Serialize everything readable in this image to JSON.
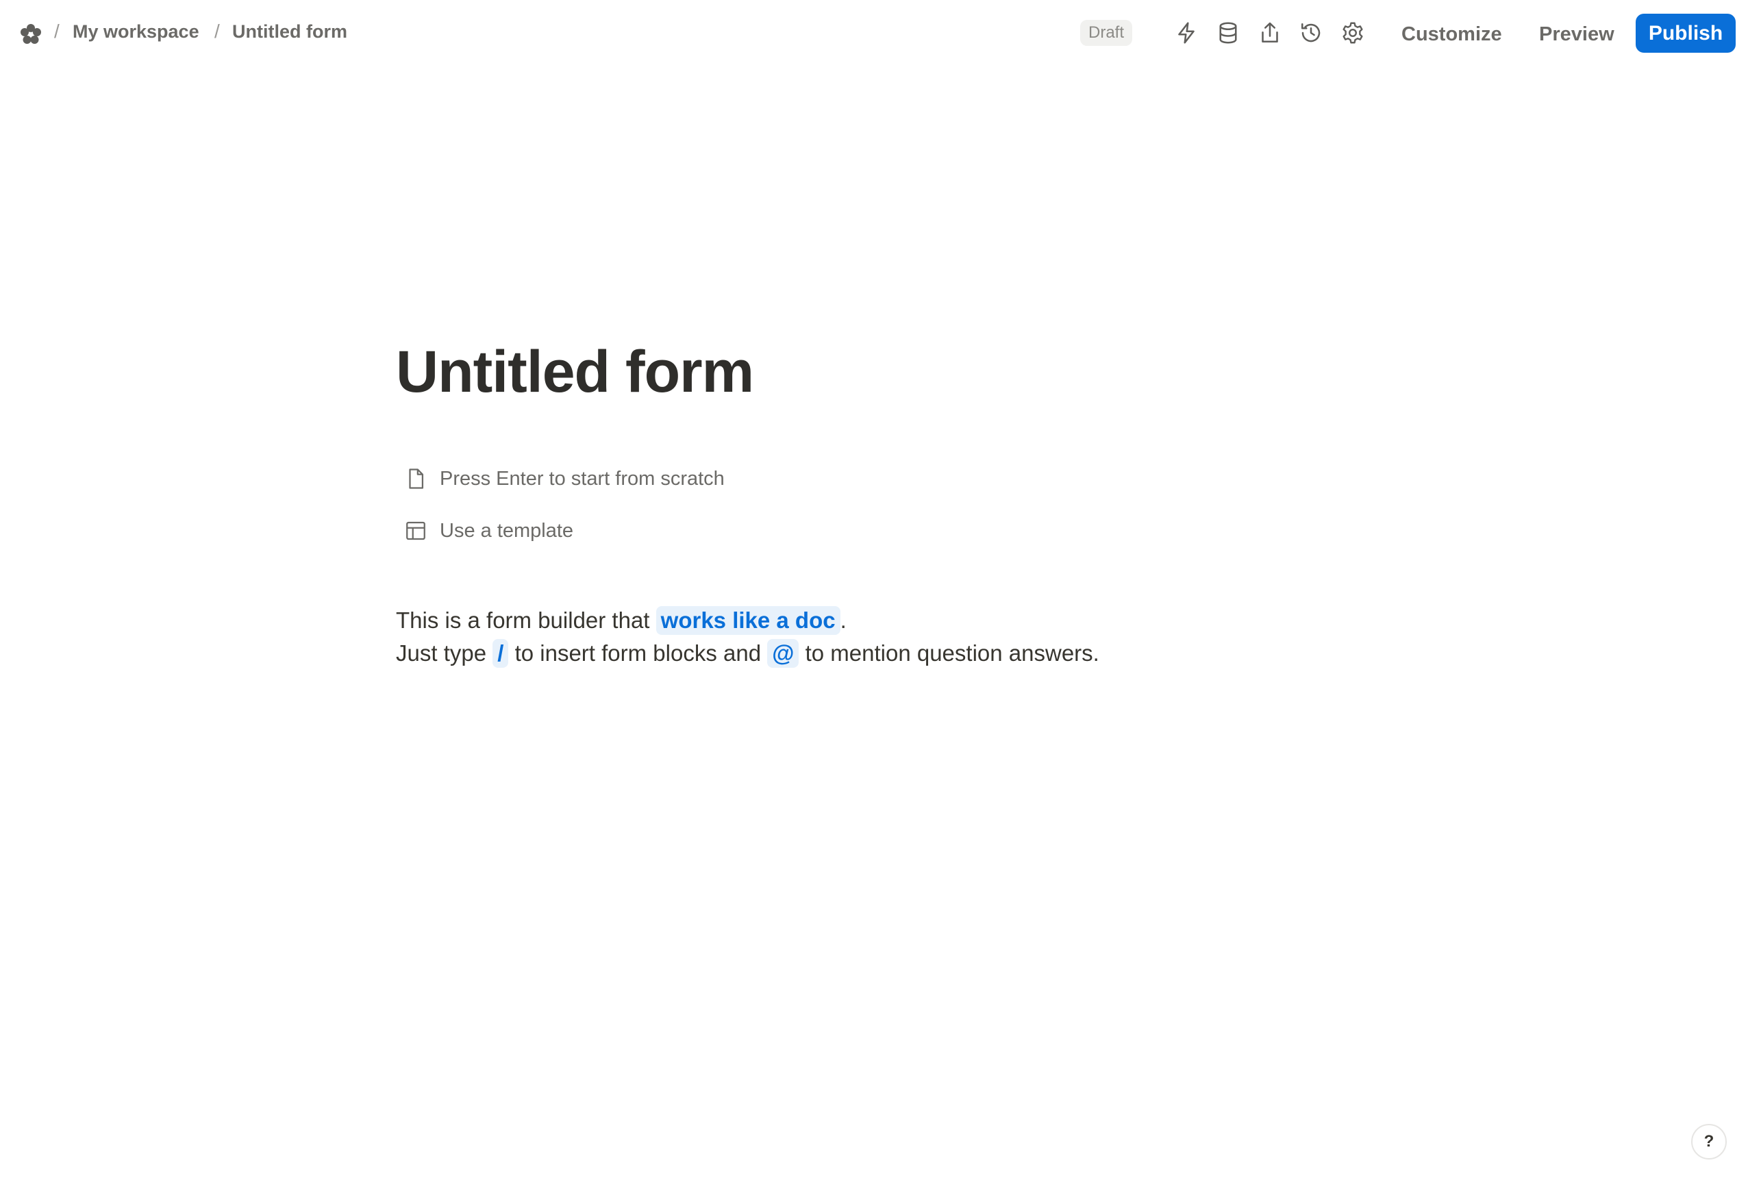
{
  "header": {
    "logo_icon": "flower-logo-icon",
    "breadcrumb": {
      "separator": "/",
      "workspace": "My workspace",
      "form": "Untitled form"
    },
    "status_badge": "Draft",
    "tools": [
      {
        "name": "automations-icon",
        "icon": "lightning-bolt"
      },
      {
        "name": "database-icon",
        "icon": "database-cylinder"
      },
      {
        "name": "share-icon",
        "icon": "upload-arrow"
      },
      {
        "name": "history-icon",
        "icon": "clock-counterclockwise"
      },
      {
        "name": "settings-icon",
        "icon": "gear"
      }
    ],
    "customize_label": "Customize",
    "preview_label": "Preview",
    "publish_label": "Publish"
  },
  "main": {
    "title": "Untitled form",
    "options": [
      {
        "label": "Press Enter to start from scratch",
        "icon": "file-icon"
      },
      {
        "label": "Use a template",
        "icon": "template-icon"
      }
    ],
    "intro": {
      "line1_prefix": "This is a form builder that ",
      "line1_highlight": "works like a doc",
      "line1_suffix": ".",
      "line2_a": "Just type ",
      "line2_key1": "/",
      "line2_b": " to insert form blocks and ",
      "line2_key2": "@",
      "line2_c": " to mention question answers."
    }
  },
  "help": {
    "label": "?"
  },
  "colors": {
    "accent": "#0a6fd8",
    "highlight_bg": "#e7f1fb",
    "muted_text": "#6b6a67"
  }
}
